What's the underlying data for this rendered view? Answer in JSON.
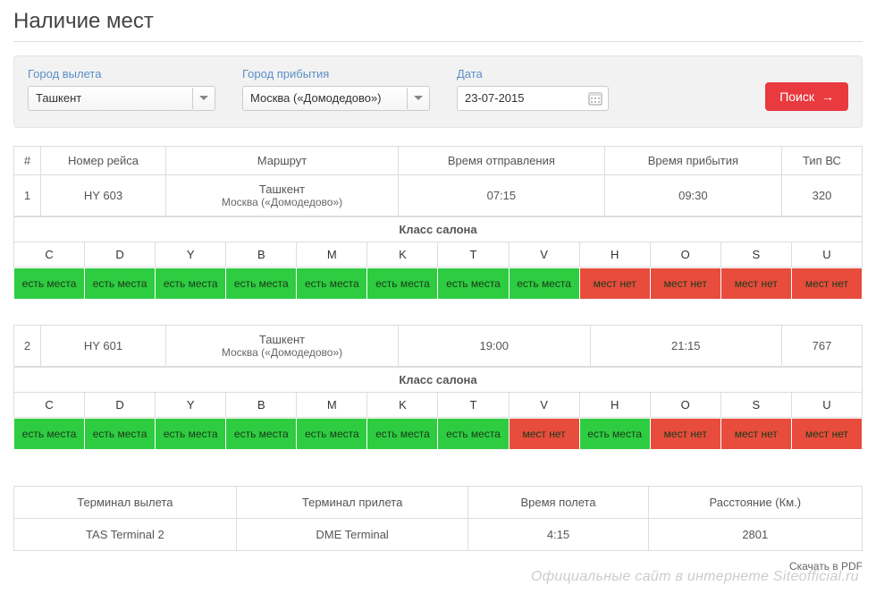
{
  "page_title": "Наличие мест",
  "search": {
    "departure_label": "Город вылета",
    "departure_value": "Ташкент",
    "arrival_label": "Город прибытия",
    "arrival_value": "Москва («Домодедово»)",
    "date_label": "Дата",
    "date_value": "23-07-2015",
    "search_button": "Поиск"
  },
  "table_headers": {
    "num": "#",
    "flight": "Номер рейса",
    "route": "Маршрут",
    "departure_time": "Время отправления",
    "arrival_time": "Время прибытия",
    "aircraft": "Тип ВС"
  },
  "cabin_header": "Класс салона",
  "class_codes": [
    "C",
    "D",
    "Y",
    "B",
    "M",
    "K",
    "T",
    "V",
    "H",
    "O",
    "S",
    "U"
  ],
  "avail_yes": "есть места",
  "avail_no": "мест нет",
  "flights": [
    {
      "num": "1",
      "flight_no": "HY 603",
      "route_from": "Ташкент",
      "route_to": "Москва («Домодедово»)",
      "dep_time": "07:15",
      "arr_time": "09:30",
      "aircraft": "320",
      "availability": [
        "yes",
        "yes",
        "yes",
        "yes",
        "yes",
        "yes",
        "yes",
        "yes",
        "no",
        "no",
        "no",
        "no"
      ]
    },
    {
      "num": "2",
      "flight_no": "HY 601",
      "route_from": "Ташкент",
      "route_to": "Москва («Домодедово»)",
      "dep_time": "19:00",
      "arr_time": "21:15",
      "aircraft": "767",
      "availability": [
        "yes",
        "yes",
        "yes",
        "yes",
        "yes",
        "yes",
        "yes",
        "no",
        "yes",
        "no",
        "no",
        "no"
      ]
    }
  ],
  "footer": {
    "dep_terminal_label": "Терминал вылета",
    "arr_terminal_label": "Терминал прилета",
    "flight_time_label": "Время полета",
    "distance_label": "Расстояние (Км.)",
    "dep_terminal": "TAS Terminal 2",
    "arr_terminal": "DME Terminal",
    "flight_time": "4:15",
    "distance": "2801"
  },
  "pdf_link": "Скачать в PDF",
  "watermark": "Официальные сайт в интернете Siteofficial.ru"
}
